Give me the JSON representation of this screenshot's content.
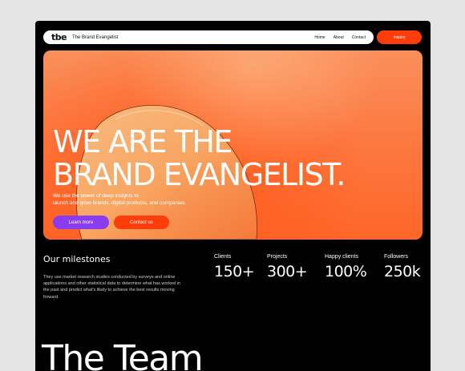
{
  "nav": {
    "logo": "tbe",
    "brand": "The Brand Evangelist",
    "links": [
      "Home",
      "About",
      "Contact"
    ],
    "enquiry": "Inquiry"
  },
  "hero": {
    "title_line1": "WE ARE THE",
    "title_line2": "BRAND EVANGELIST.",
    "subtitle_line1": "We use the power of deep insights to",
    "subtitle_line2": "launch and grow brands, digital products, and companies.",
    "learn_more": "Learn more",
    "contact_us": "Contact us"
  },
  "milestones": {
    "title": "Our milestones",
    "description": "They use market research studies conducted by surveys and online applications and other statistical data to determine what has worked in the past and predict what's likely to achieve the best results moving forward.",
    "stats": [
      {
        "label": "Clients",
        "value": "150+"
      },
      {
        "label": "Projects",
        "value": "300+"
      },
      {
        "label": "Happy clients",
        "value": "100%"
      },
      {
        "label": "Followers",
        "value": "250k"
      }
    ]
  },
  "team": {
    "title": "The Team"
  },
  "colors": {
    "accent": "#ff3d0b",
    "purple": "#8a3df0",
    "background": "#000000",
    "page": "#e4e4e4"
  }
}
